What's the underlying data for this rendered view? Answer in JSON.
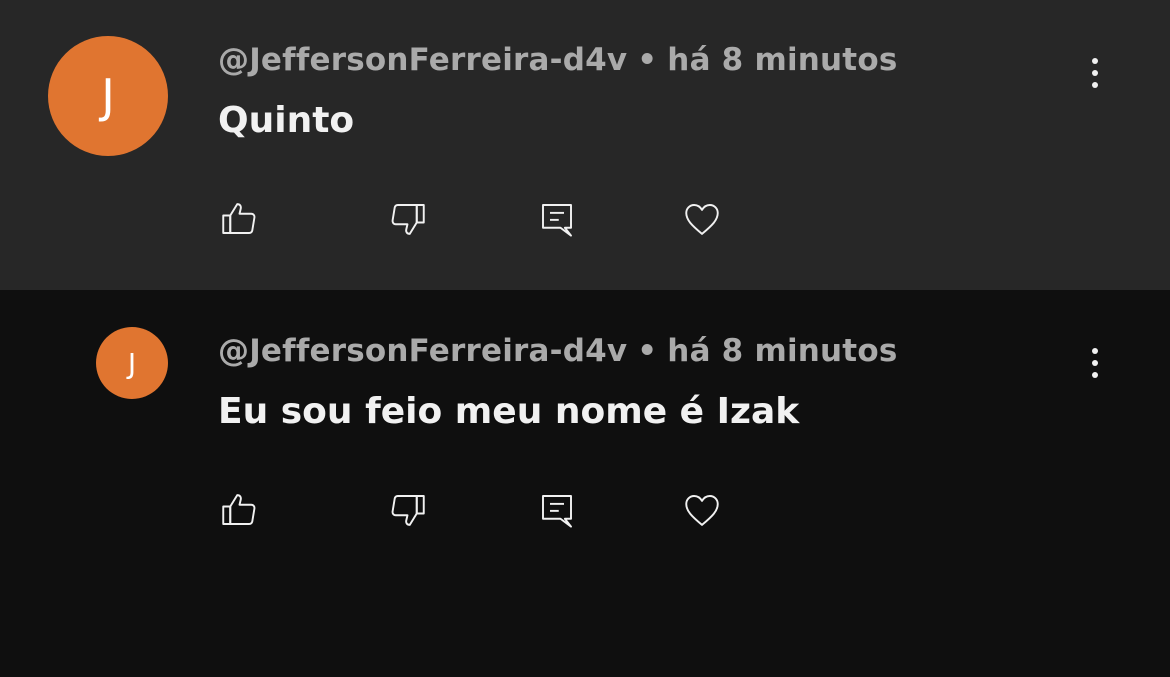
{
  "comments": [
    {
      "avatar_letter": "J",
      "author": "@JeffersonFerreira-d4v",
      "separator": "•",
      "time": "há 8 minutos",
      "text": "Quinto"
    },
    {
      "avatar_letter": "J",
      "author": "@JeffersonFerreira-d4v",
      "separator": "•",
      "time": "há 8 minutos",
      "text": "Eu sou feio meu nome é Izak"
    }
  ],
  "icons": {
    "like": "thumb-up-icon",
    "dislike": "thumb-down-icon",
    "reply": "reply-comment-icon",
    "heart": "heart-icon",
    "more": "more-vertical-icon"
  },
  "colors": {
    "top_background": "#272727",
    "reply_background": "#0f0f0f",
    "avatar": "#e07530",
    "meta_text": "#aaaaaa",
    "text": "#f1f1f1"
  }
}
